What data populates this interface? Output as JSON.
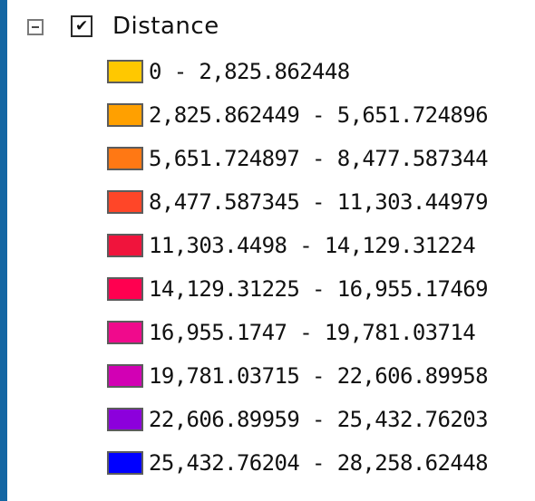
{
  "layer": {
    "name": "Distance",
    "checked": true,
    "expanded": true,
    "expander_icon": "minus-box-icon",
    "check_icon": "checkmark-icon"
  },
  "legend": {
    "items": [
      {
        "label": "0 - 2,825.862448",
        "color": "#ffc800"
      },
      {
        "label": "2,825.862449 - 5,651.724896",
        "color": "#ffa000"
      },
      {
        "label": "5,651.724897 - 8,477.587344",
        "color": "#ff7814"
      },
      {
        "label": "8,477.587345 - 11,303.44979",
        "color": "#ff4628"
      },
      {
        "label": "11,303.4498 - 14,129.31224",
        "color": "#f0143c"
      },
      {
        "label": "14,129.31225 - 16,955.17469",
        "color": "#ff0050"
      },
      {
        "label": "16,955.1747 - 19,781.03714",
        "color": "#f00a8c"
      },
      {
        "label": "19,781.03715 - 22,606.89958",
        "color": "#d200b4"
      },
      {
        "label": "22,606.89959 - 25,432.76203",
        "color": "#8c00dc"
      },
      {
        "label": "25,432.76204 - 28,258.62448",
        "color": "#0000ff"
      }
    ]
  }
}
